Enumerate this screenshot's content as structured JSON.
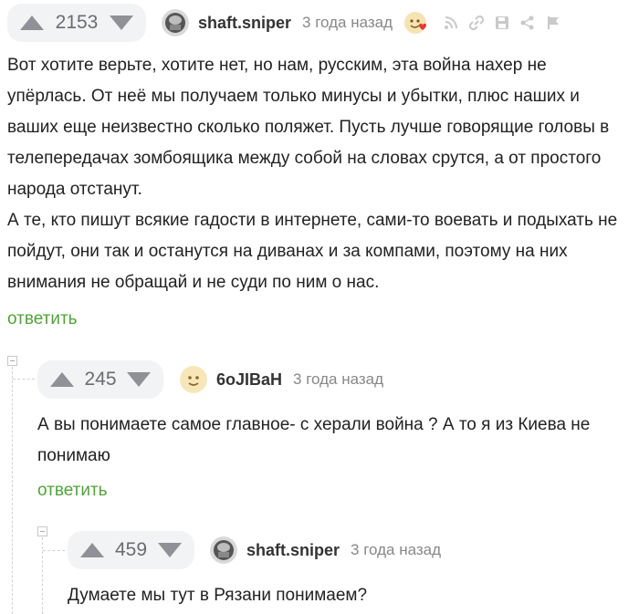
{
  "comments": [
    {
      "rating": "2153",
      "author": "shaft.sniper",
      "time": "3 года назад",
      "paragraphs": [
        "Вот хотите верьте, хотите нет, но нам, русским, эта война нахер не упёрлась. От неё мы получаем только минусы и убытки, плюс наших и ваших еще неизвестно сколько поляжет. Пусть лучше говорящие головы в телепередачах зомбоящика между собой на словах срутся, а от простого народа отстанут.",
        "А те, кто пишут всякие гадости в интернете, сами-то воевать и подыхать не пойдут, они так и останутся на диванах и за компами, поэтому на них внимания не обращай и не суди по ним о нас."
      ],
      "reply_label": "ответить",
      "action_icons": [
        "rss-icon",
        "link-icon",
        "save-icon",
        "share-icon",
        "flag-icon"
      ]
    },
    {
      "rating": "245",
      "author": "6oJIBaH",
      "time": "3 года назад",
      "text": "А вы понимаете самое главное- с херали война ? А то я из Киева не понимаю",
      "reply_label": "ответить"
    },
    {
      "rating": "459",
      "author": "shaft.sniper",
      "time": "3 года назад",
      "text": "Думаете мы тут в Рязани понимаем?"
    }
  ],
  "colors": {
    "reply": "#51a23a",
    "rating_bg": "#f2f3f5",
    "arrow": "#8f9196"
  }
}
